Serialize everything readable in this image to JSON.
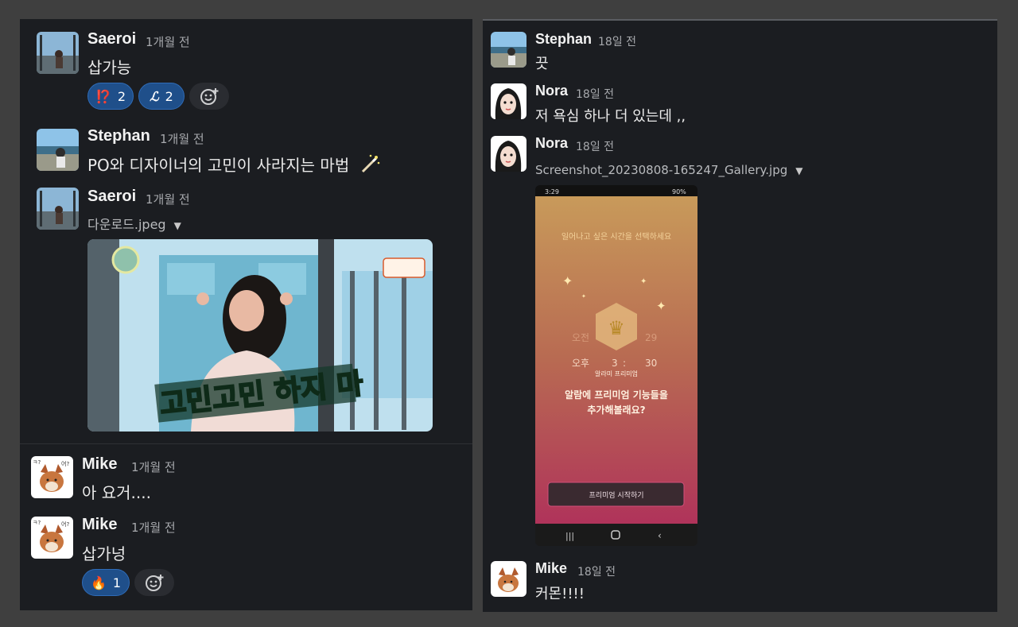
{
  "left": {
    "messages": [
      {
        "name": "Saeroi",
        "time": "1개월 전",
        "text": "삽가능",
        "reactions": [
          {
            "emoji": "⁉️",
            "count": "2"
          },
          {
            "emoji": "ℒ",
            "count": "2"
          }
        ]
      },
      {
        "name": "Stephan",
        "time": "1개월 전",
        "text": "PO와 디자이너의 고민이 사라지는 마법"
      },
      {
        "name": "Saeroi",
        "time": "1개월 전",
        "file": "다운로드.jpeg",
        "image_caption": "고민고민 하지 마"
      },
      {
        "name": "Mike",
        "time": "1개월 전",
        "text": "아 요거...."
      },
      {
        "name": "Mike",
        "time": "1개월 전",
        "text": "삽가넝",
        "reactions": [
          {
            "emoji": "🔥",
            "count": "1"
          }
        ]
      }
    ]
  },
  "right": {
    "messages": [
      {
        "name": "Stephan",
        "time": "18일 전",
        "text": "끗"
      },
      {
        "name": "Nora",
        "time": "18일 전",
        "text": "저 욕심 하나 더 있는데 ,,"
      },
      {
        "name": "Nora",
        "time": "18일 전",
        "file": "Screenshot_20230808-165247_Gallery.jpg"
      },
      {
        "name": "Mike",
        "time": "18일 전",
        "text": "커몬!!!!"
      }
    ],
    "phone": {
      "status_time": "3:29",
      "status_right": "90%",
      "heading": "일어나고 싶은 시간을 선택하세요",
      "ampm_am": "오전",
      "min_top": "29",
      "ampm_pm": "오후",
      "hour": "3",
      "minute": "30",
      "badge": "알라미 프리미엄",
      "question_line1": "알람에 프리미엄 기능들을",
      "question_line2": "추가해볼래요?",
      "button": "프리미엄 시작하기"
    }
  },
  "colors": {
    "panel": "#1b1d21",
    "reaction": "#1f4f8a",
    "page": "#3f3f3f"
  }
}
